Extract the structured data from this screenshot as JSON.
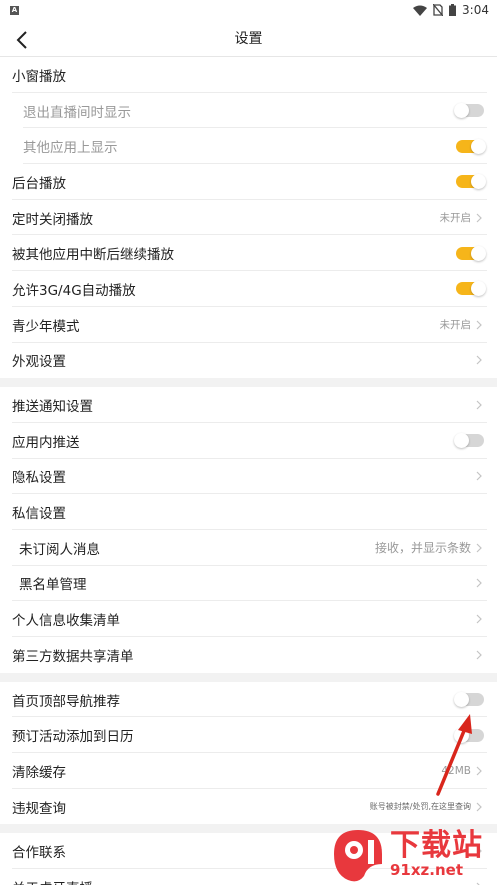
{
  "status_bar": {
    "time": "3:04"
  },
  "nav": {
    "title": "设置"
  },
  "groups": [
    [
      {
        "label": "小窗播放",
        "type": "header"
      },
      {
        "label": "退出直播间时显示",
        "type": "toggle",
        "on": false,
        "sub": true
      },
      {
        "label": "其他应用上显示",
        "type": "toggle",
        "on": true,
        "sub": true
      },
      {
        "label": "后台播放",
        "type": "toggle",
        "on": true
      },
      {
        "label": "定时关闭播放",
        "type": "link",
        "value": "未开启"
      },
      {
        "label": "被其他应用中断后继续播放",
        "type": "toggle",
        "on": true
      },
      {
        "label": "允许3G/4G自动播放",
        "type": "toggle",
        "on": true
      },
      {
        "label": "青少年模式",
        "type": "link",
        "value": "未开启"
      },
      {
        "label": "外观设置",
        "type": "link"
      }
    ],
    [
      {
        "label": "推送通知设置",
        "type": "link"
      },
      {
        "label": "应用内推送",
        "type": "toggle",
        "on": false
      },
      {
        "label": "隐私设置",
        "type": "link"
      },
      {
        "label": "私信设置",
        "type": "header"
      },
      {
        "label": "未订阅人消息",
        "type": "link",
        "value": "接收，并显示条数",
        "sub2": true
      },
      {
        "label": "黑名单管理",
        "type": "link",
        "sub2": true
      },
      {
        "label": "个人信息收集清单",
        "type": "link"
      },
      {
        "label": "第三方数据共享清单",
        "type": "link"
      }
    ],
    [
      {
        "label": "首页顶部导航推荐",
        "type": "toggle",
        "on": false
      },
      {
        "label": "预订活动添加到日历",
        "type": "toggle",
        "on": false
      },
      {
        "label": "清除缓存",
        "type": "link",
        "value": "42MB"
      },
      {
        "label": "违规查询",
        "type": "link",
        "value": "账号被封禁/处罚,在这里查询",
        "small": true
      }
    ],
    [
      {
        "label": "合作联系",
        "type": "link"
      },
      {
        "label": "关于虎牙直播",
        "type": "link"
      }
    ]
  ],
  "watermark": {
    "title": "下载站",
    "url": "91xz.net"
  },
  "colors": {
    "accent": "#f6b51a",
    "arrow": "#d9261c",
    "watermark": "#e8383d"
  }
}
